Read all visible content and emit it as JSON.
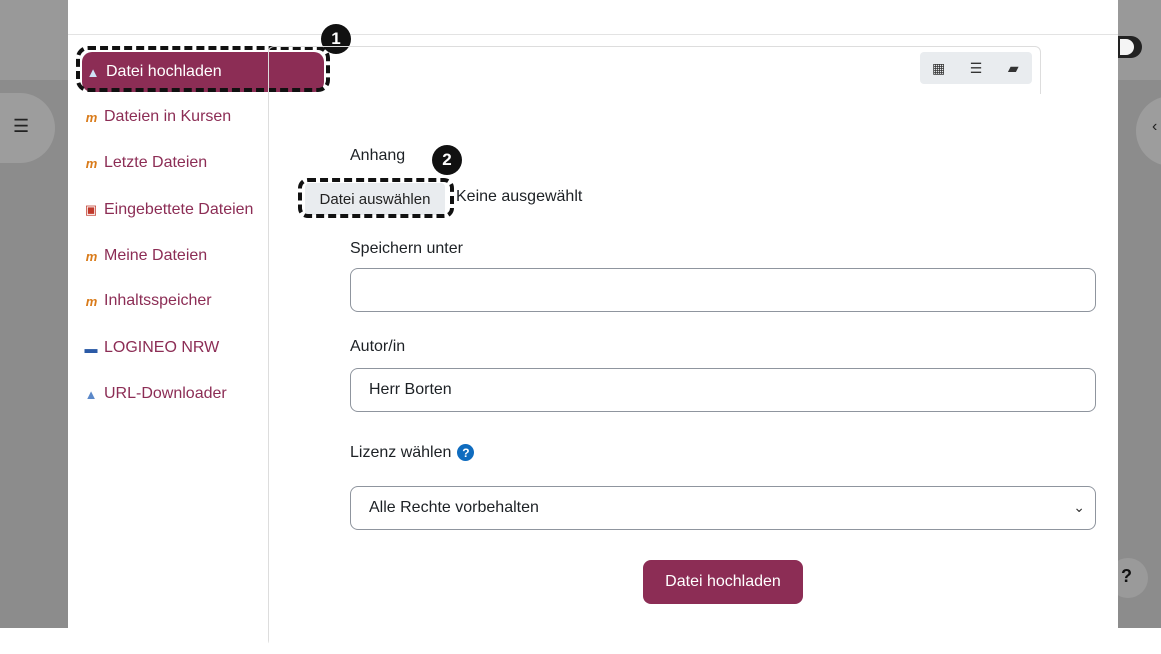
{
  "sidebar": {
    "items": [
      {
        "label": "Datei hochladen"
      },
      {
        "label": "Dateien in Kursen"
      },
      {
        "label": "Letzte Dateien"
      },
      {
        "label": "Eingebettete Dateien"
      },
      {
        "label": "Meine Dateien"
      },
      {
        "label": "Inhaltsspeicher"
      },
      {
        "label": "LOGINEO NRW"
      },
      {
        "label": "URL-Downloader"
      }
    ]
  },
  "annotations": {
    "badge1": "1",
    "badge2": "2"
  },
  "form": {
    "attachment_label": "Anhang",
    "file_button_label": "Datei auswählen",
    "no_file_text": "Keine ausgewählt",
    "save_as_label": "Speichern unter",
    "save_as_value": "",
    "author_label": "Autor/in",
    "author_value": "Herr Borten",
    "license_label": "Lizenz wählen",
    "license_value": "Alle Rechte vorbehalten",
    "submit_label": "Datei hochladen"
  },
  "background": {
    "help_glyph": "?"
  },
  "colors": {
    "accent": "#8c2d55",
    "info": "#0f6cbf"
  }
}
